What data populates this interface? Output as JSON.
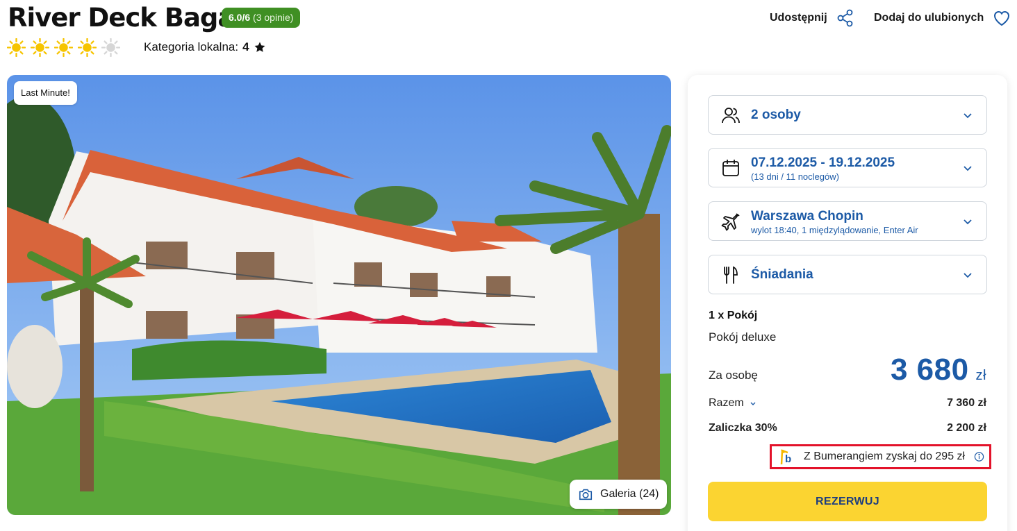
{
  "hotel": {
    "name": "River Deck Baga",
    "rating": "6.0/6",
    "reviews": "(3 opinie)",
    "sun_rating": 4,
    "sun_max": 5,
    "local_category_label": "Kategoria lokalna:",
    "local_category_value": "4"
  },
  "header_actions": {
    "share_label": "Udostępnij",
    "favorite_label": "Dodaj do ulubionych"
  },
  "photo": {
    "badge": "Last Minute!",
    "gallery_label": "Galeria (24)"
  },
  "booking": {
    "persons": "2 osoby",
    "dates": "07.12.2025 - 19.12.2025",
    "duration": "(13 dni / 11 noclegów)",
    "departure_airport": "Warszawa Chopin",
    "flight_info": "wylot 18:40, 1 międzylądowanie, Enter Air",
    "board": "Śniadania",
    "room_qty": "1 x Pokój",
    "room_name": "Pokój deluxe",
    "per_person_label": "Za osobę",
    "price_per_person": "3 680",
    "currency": "zł",
    "total_label": "Razem",
    "total_value": "7 360 zł",
    "deposit_label": "Zaliczka 30%",
    "deposit_value": "2 200 zł",
    "boomerang_text": "Z Bumerangiem zyskaj do 295 zł",
    "book_button": "REZERWUJ"
  },
  "colors": {
    "accent_blue": "#1c5aa6",
    "rating_green": "#3f8f23",
    "book_yellow": "#fbd431",
    "highlight_red": "#e3122a",
    "sun_yellow": "#f6c400"
  },
  "icons": {
    "persons": "users-icon",
    "dates": "calendar-icon",
    "flight": "plane-icon",
    "board": "fork-knife-icon",
    "share": "share-icon",
    "favorite": "heart-icon",
    "gallery": "camera-icon",
    "info": "info-icon",
    "star": "star-icon",
    "sun": "sun-icon"
  }
}
